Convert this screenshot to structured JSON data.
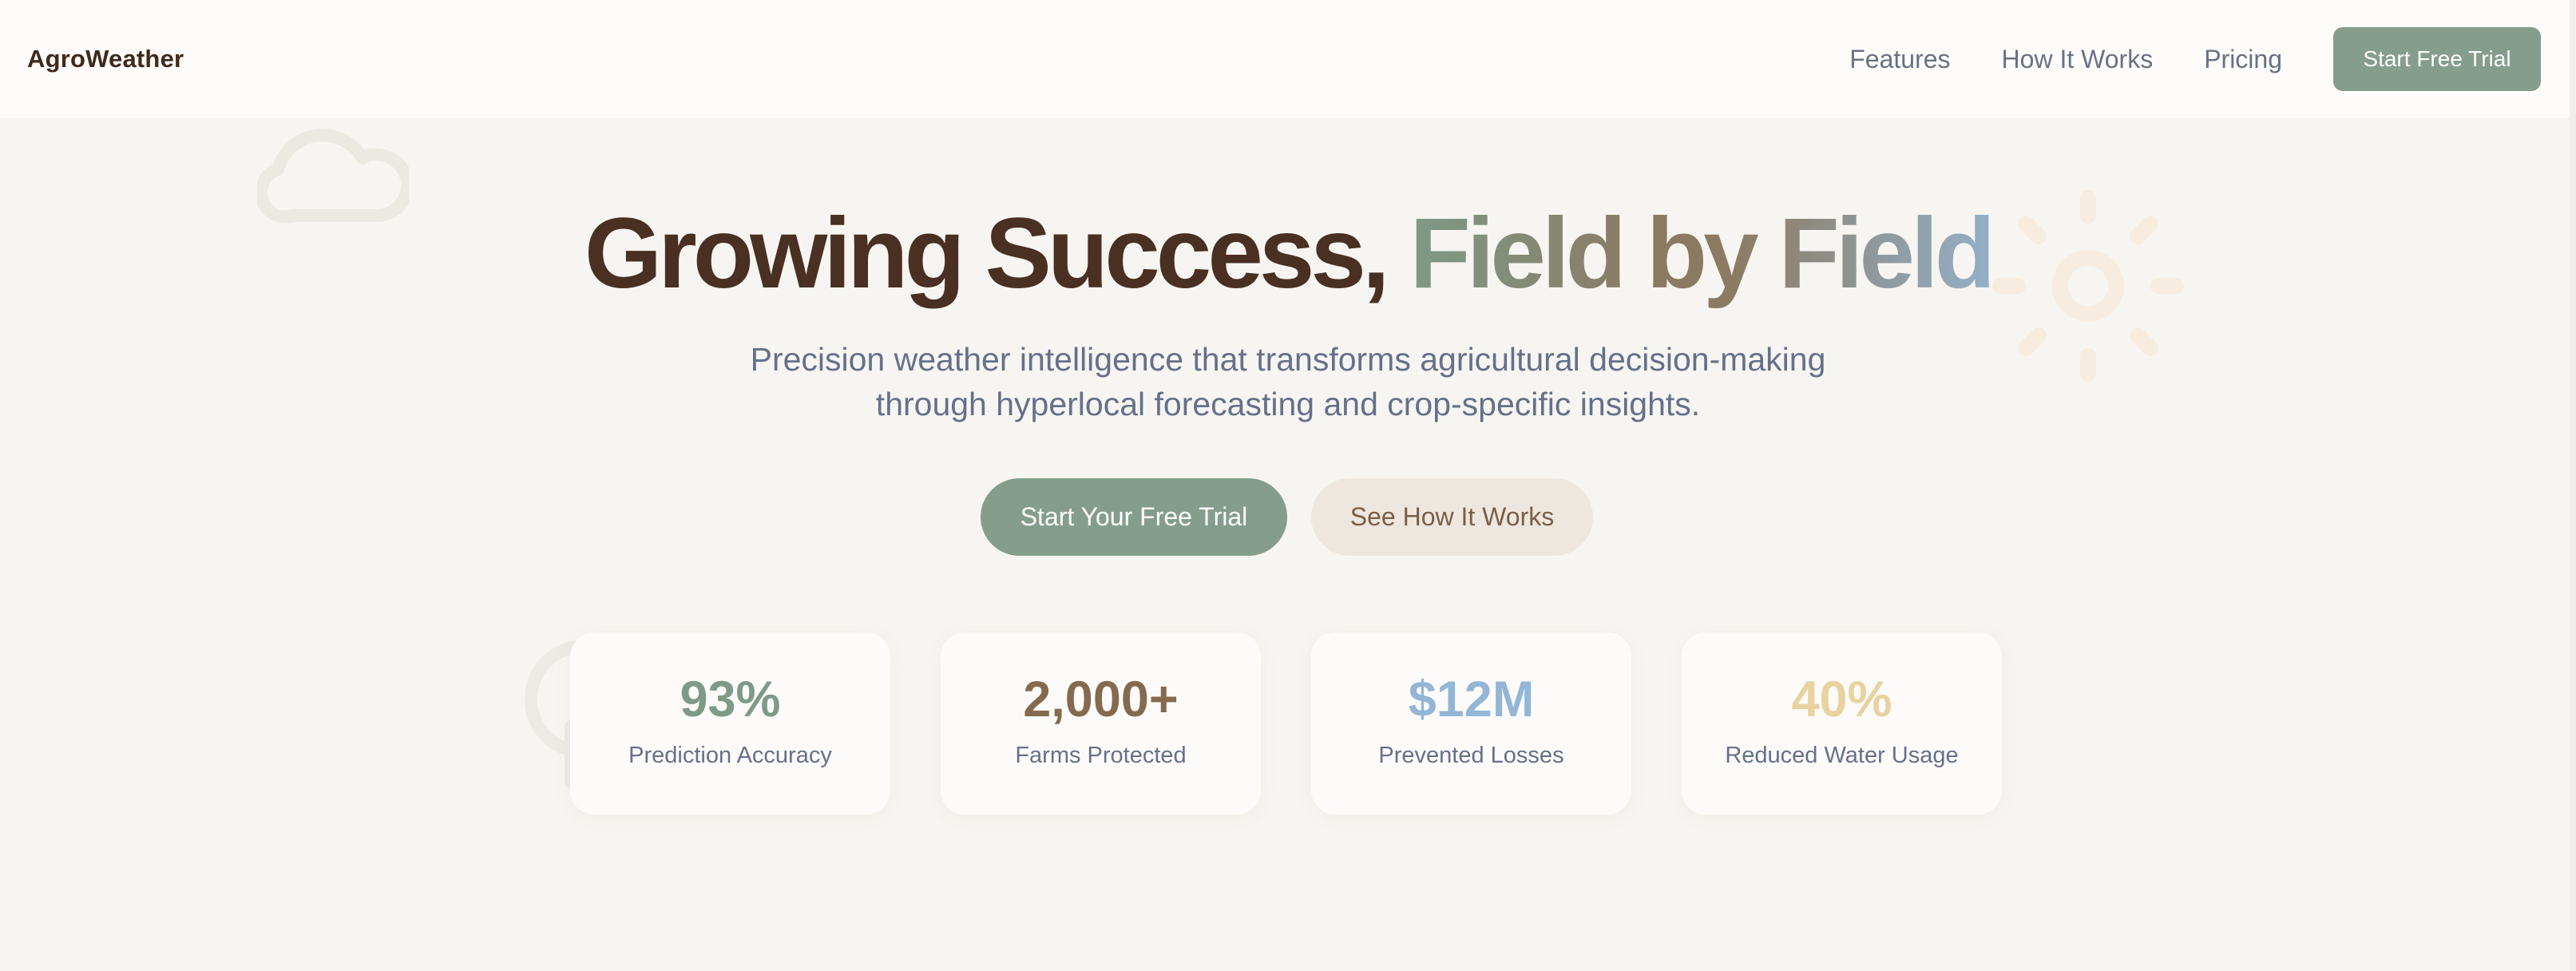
{
  "nav": {
    "brand": "AgroWeather",
    "links": [
      "Features",
      "How It Works",
      "Pricing"
    ],
    "cta_label": "Start Free Trial"
  },
  "hero": {
    "title_main": "Growing Success,",
    "title_accent": "Field by Field",
    "subtitle_line1": "Precision weather intelligence that transforms agricultural decision-making",
    "subtitle_line2": "through hyperlocal forecasting and crop-specific insights.",
    "primary_cta": "Start Your Free Trial",
    "secondary_cta": "See How It Works"
  },
  "stats": [
    {
      "value": "93%",
      "label": "Prediction Accuracy",
      "color": "#7e9a89"
    },
    {
      "value": "2,000+",
      "label": "Farms Protected",
      "color": "#856a4f"
    },
    {
      "value": "$12M",
      "label": "Prevented Losses",
      "color": "#93b6d6"
    },
    {
      "value": "40%",
      "label": "Reduced Water Usage",
      "color": "#e8d29f"
    }
  ],
  "icons": [
    "cloud-icon",
    "sun-icon",
    "umbrella-icon"
  ]
}
